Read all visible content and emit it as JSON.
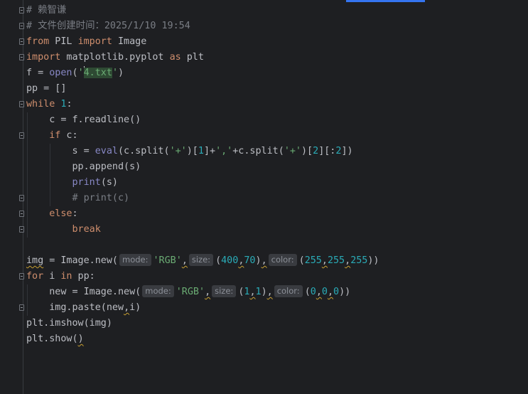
{
  "editor": {
    "lines": [
      {
        "tokens": [
          {
            "t": "cm",
            "v": "# 赖智谦"
          }
        ]
      },
      {
        "tokens": [
          {
            "t": "cm",
            "v": "# 文件创建时间：2025/1/10 19:54"
          }
        ]
      },
      {
        "tokens": [
          {
            "t": "kw",
            "v": "from"
          },
          {
            "t": "",
            "v": " PIL "
          },
          {
            "t": "kw",
            "v": "import"
          },
          {
            "t": "",
            "v": " Image"
          }
        ]
      },
      {
        "tokens": [
          {
            "t": "kw",
            "v": "import"
          },
          {
            "t": "",
            "v": " matplotlib.pyplot "
          },
          {
            "t": "kw",
            "v": "as"
          },
          {
            "t": "",
            "v": " plt"
          }
        ]
      },
      {
        "tokens": [
          {
            "t": "",
            "v": "f = "
          },
          {
            "t": "bi",
            "v": "open"
          },
          {
            "t": "",
            "v": "("
          },
          {
            "t": "str",
            "v": "'"
          },
          {
            "t": "caret",
            "v": ""
          },
          {
            "t": "str hl-sel",
            "v": "4.txt"
          },
          {
            "t": "str",
            "v": "'"
          },
          {
            "t": "",
            "v": ")"
          }
        ]
      },
      {
        "tokens": [
          {
            "t": "",
            "v": "pp = []"
          }
        ]
      },
      {
        "tokens": [
          {
            "t": "kw",
            "v": "while"
          },
          {
            "t": "",
            "v": " "
          },
          {
            "t": "num",
            "v": "1"
          },
          {
            "t": "",
            "v": ":"
          }
        ]
      },
      {
        "tokens": [
          {
            "t": "",
            "v": "    c = f.readline()"
          }
        ]
      },
      {
        "tokens": [
          {
            "t": "",
            "v": "    "
          },
          {
            "t": "kw",
            "v": "if"
          },
          {
            "t": "",
            "v": " c:"
          }
        ]
      },
      {
        "tokens": [
          {
            "t": "",
            "v": "        s = "
          },
          {
            "t": "bi",
            "v": "eval"
          },
          {
            "t": "",
            "v": "(c.split("
          },
          {
            "t": "str",
            "v": "'+'"
          },
          {
            "t": "",
            "v": ")["
          },
          {
            "t": "num",
            "v": "1"
          },
          {
            "t": "",
            "v": "]+"
          },
          {
            "t": "str",
            "v": "','"
          },
          {
            "t": "",
            "v": "+c.split("
          },
          {
            "t": "str",
            "v": "'+'"
          },
          {
            "t": "",
            "v": ")["
          },
          {
            "t": "num",
            "v": "2"
          },
          {
            "t": "",
            "v": "][:"
          },
          {
            "t": "num",
            "v": "2"
          },
          {
            "t": "",
            "v": "])"
          }
        ]
      },
      {
        "tokens": [
          {
            "t": "",
            "v": "        pp.append(s)"
          }
        ]
      },
      {
        "tokens": [
          {
            "t": "",
            "v": "        "
          },
          {
            "t": "bi",
            "v": "print"
          },
          {
            "t": "",
            "v": "(s)"
          }
        ]
      },
      {
        "tokens": [
          {
            "t": "",
            "v": "        "
          },
          {
            "t": "cm",
            "v": "# print(c)"
          }
        ]
      },
      {
        "tokens": [
          {
            "t": "",
            "v": "    "
          },
          {
            "t": "kw",
            "v": "else"
          },
          {
            "t": "",
            "v": ":"
          }
        ]
      },
      {
        "tokens": [
          {
            "t": "",
            "v": "        "
          },
          {
            "t": "kw",
            "v": "break"
          }
        ]
      },
      {
        "tokens": []
      },
      {
        "tokens": [
          {
            "t": "squig",
            "v": "img"
          },
          {
            "t": "",
            "v": " = Image.new("
          },
          {
            "t": "hint",
            "v": "mode:"
          },
          {
            "t": "str",
            "v": "'RGB'"
          },
          {
            "t": "squig",
            "v": ","
          },
          {
            "t": "hint",
            "v": "size:"
          },
          {
            "t": "",
            "v": "("
          },
          {
            "t": "num",
            "v": "400"
          },
          {
            "t": "squig",
            "v": ","
          },
          {
            "t": "num",
            "v": "70"
          },
          {
            "t": "",
            "v": ")"
          },
          {
            "t": "squig",
            "v": ","
          },
          {
            "t": "hint",
            "v": "color:"
          },
          {
            "t": "",
            "v": "("
          },
          {
            "t": "num",
            "v": "255"
          },
          {
            "t": "squig",
            "v": ","
          },
          {
            "t": "num",
            "v": "255"
          },
          {
            "t": "squig",
            "v": ","
          },
          {
            "t": "num",
            "v": "255"
          },
          {
            "t": "",
            "v": "))"
          }
        ]
      },
      {
        "tokens": [
          {
            "t": "kw",
            "v": "for"
          },
          {
            "t": "",
            "v": " i "
          },
          {
            "t": "kw",
            "v": "in"
          },
          {
            "t": "",
            "v": " pp:"
          }
        ]
      },
      {
        "tokens": [
          {
            "t": "",
            "v": "    new = Image.new("
          },
          {
            "t": "hint",
            "v": "mode:"
          },
          {
            "t": "str",
            "v": "'RGB'"
          },
          {
            "t": "squig",
            "v": ","
          },
          {
            "t": "hint",
            "v": "size:"
          },
          {
            "t": "",
            "v": "("
          },
          {
            "t": "num",
            "v": "1"
          },
          {
            "t": "squig",
            "v": ","
          },
          {
            "t": "num",
            "v": "1"
          },
          {
            "t": "",
            "v": ")"
          },
          {
            "t": "squig",
            "v": ","
          },
          {
            "t": "hint",
            "v": "color:"
          },
          {
            "t": "",
            "v": "("
          },
          {
            "t": "num",
            "v": "0"
          },
          {
            "t": "squig",
            "v": ","
          },
          {
            "t": "num",
            "v": "0"
          },
          {
            "t": "squig",
            "v": ","
          },
          {
            "t": "num",
            "v": "0"
          },
          {
            "t": "",
            "v": "))"
          }
        ]
      },
      {
        "tokens": [
          {
            "t": "",
            "v": "    img.paste(new"
          },
          {
            "t": "squig",
            "v": ","
          },
          {
            "t": "",
            "v": "i)"
          }
        ]
      },
      {
        "tokens": [
          {
            "t": "",
            "v": "plt.imshow(img)"
          }
        ]
      },
      {
        "tokens": [
          {
            "t": "",
            "v": "plt.show("
          },
          {
            "t": "squig",
            "v": ")"
          }
        ]
      }
    ]
  },
  "colors": {
    "background": "#1e1f22",
    "keyword": "#cf8e6d",
    "string": "#6aab73",
    "number": "#2aacb8",
    "builtin": "#8888c6",
    "comment": "#7a7e85",
    "accent": "#3574f0"
  },
  "icons": {
    "fold_marker": "fold-marker-icon"
  }
}
